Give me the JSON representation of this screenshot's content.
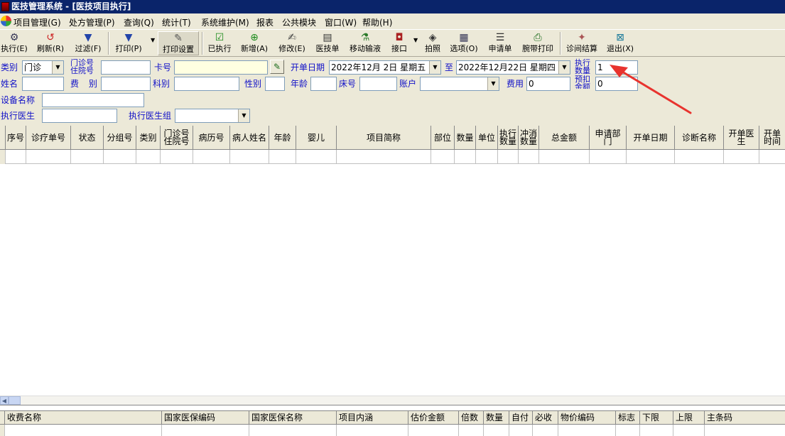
{
  "window": {
    "title": "医技管理系统 - [医技项目执行]"
  },
  "menu": [
    "项目管理(G)",
    "处方管理(P)",
    "查询(Q)",
    "统计(T)",
    "系统维护(M)",
    "报表",
    "公共模块",
    "窗口(W)",
    "帮助(H)"
  ],
  "toolbar": {
    "execute": "执行(E)",
    "refresh": "刷新(R)",
    "filter": "过滤(F)",
    "print": "打印(P)",
    "print_settings": "打印设置",
    "executed": "已执行",
    "add": "新增(A)",
    "modify": "修改(E)",
    "tech_form": "医技单",
    "mobile_infusion": "移动输液",
    "interface": "接口",
    "photo": "拍照",
    "options": "选项(O)",
    "request_form": "申请单",
    "wristband_print": "腕带打印",
    "visit_settle": "诊间结算",
    "exit": "退出(X)",
    "icons": {
      "execute": "gear-icon",
      "refresh": "refresh-icon",
      "filter": "funnel-icon",
      "print": "funnel-icon",
      "print_settings": "wrench-icon",
      "executed": "checkmark-icon",
      "add": "plus-icon",
      "modify": "edit-icon",
      "tech_form": "clipboard-icon",
      "mobile_infusion": "infusion-icon",
      "interface": "connector-icon",
      "photo": "camera-icon",
      "options": "options-icon",
      "request_form": "form-icon",
      "wristband_print": "printer-icon",
      "visit_settle": "settle-icon",
      "exit": "exit-icon"
    }
  },
  "filter": {
    "category_label": "类别",
    "category_value": "门诊",
    "outpatient_no_label": "门诊号",
    "inpatient_no_label": "住院号",
    "outpatient_no_value": "",
    "card_label": "卡号",
    "card_value": "",
    "open_date_label": "开单日期",
    "date_from": "2022年12月 2日 星期五",
    "to_label": "至",
    "date_to": "2022年12月22日 星期四",
    "exec_qty_label1": "执行",
    "exec_qty_label2": "数量",
    "exec_qty_value": "1",
    "name_label": "姓名",
    "name_value": "",
    "fee_type_label": "费 别",
    "fee_type_value": "",
    "dept_label": "科别",
    "dept_value": "",
    "sex_label": "性别",
    "sex_value": "",
    "age_label": "年龄",
    "age_value": "",
    "bed_label": "床号",
    "bed_value": "",
    "account_label": "账户",
    "account_value": "",
    "fee_label": "费用",
    "fee_value": "0",
    "prepay_label1": "预扣",
    "prepay_label2": "金额",
    "prepay_value": "0",
    "device_label": "设备名称",
    "device_value": "",
    "doctor_label": "执行医生",
    "doctor_value": "",
    "doctor_group_label": "执行医生组",
    "doctor_group_value": ""
  },
  "grid_columns": [
    "序号",
    "诊疗单号",
    "状态",
    "分组号",
    "类别",
    "门诊号\n住院号",
    "病历号",
    "病人姓名",
    "年龄",
    "婴儿",
    "项目简称",
    "部位",
    "数量",
    "单位",
    "执行\n数量",
    "冲消\n数量",
    "总金额",
    "申请部\n门",
    "开单日期",
    "诊断名称",
    "开单医\n生",
    "开单\n时间"
  ],
  "bottom_columns": [
    "收费名称",
    "国家医保编码",
    "国家医保名称",
    "项目内涵",
    "估价金额",
    "倍数",
    "数量",
    "自付",
    "必收",
    "物价编码",
    "标志",
    "下限",
    "上限",
    "主条码"
  ],
  "colors": {
    "titlebar": "#0a246a",
    "label_blue": "#1010c8",
    "arrow_red": "#e8332e",
    "face": "#ece9d8"
  }
}
